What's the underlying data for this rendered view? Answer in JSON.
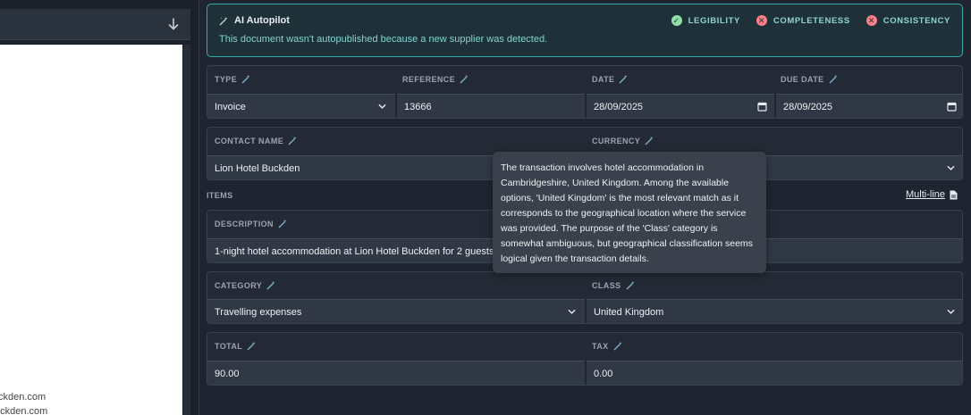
{
  "document_preview": {
    "text_lines": [
      "ckden.com",
      "uckden.com"
    ]
  },
  "autopilot": {
    "title": "AI Autopilot",
    "message": "This document wasn't autopublished because a new supplier was detected.",
    "checks": [
      {
        "label": "LEGIBILITY",
        "status": "pass"
      },
      {
        "label": "COMPLETENESS",
        "status": "fail"
      },
      {
        "label": "CONSISTENCY",
        "status": "fail"
      }
    ]
  },
  "fields": {
    "type": {
      "label": "TYPE",
      "value": "Invoice"
    },
    "reference": {
      "label": "REFERENCE",
      "value": "13666"
    },
    "date": {
      "label": "DATE",
      "value": "28/09/2025"
    },
    "due_date": {
      "label": "DUE DATE",
      "value": "28/09/2025"
    },
    "contact_name": {
      "label": "CONTACT NAME",
      "value": "Lion Hotel Buckden"
    },
    "currency": {
      "label": "CURRENCY",
      "value": ""
    }
  },
  "items": {
    "label": "ITEMS",
    "multiline_label": "Multi-line",
    "description": {
      "label": "DESCRIPTION",
      "value": "1-night hotel accommodation at Lion Hotel Buckden for 2 guests"
    },
    "category": {
      "label": "CATEGORY",
      "value": "Travelling expenses"
    },
    "class": {
      "label": "CLASS",
      "value": "United Kingdom"
    },
    "total": {
      "label": "TOTAL",
      "value": "90.00"
    },
    "tax": {
      "label": "TAX",
      "value": "0.00"
    }
  },
  "tooltip": {
    "text": "The transaction involves hotel accommodation in Cambridgeshire, United Kingdom. Among the available options, 'United Kingdom' is the most relevant match as it corresponds to the geographical location where the service was provided. The purpose of the 'Class' category is somewhat ambiguous, but geographical classification seems logical given the transaction details."
  },
  "colors": {
    "accent_teal": "#3aa8a8",
    "pass_green": "#8fe0a8",
    "fail_red": "#ff7f86"
  },
  "icons": {
    "wand": "magic-wand-icon",
    "chevron": "chevron-down-icon",
    "calendar": "calendar-icon",
    "download": "download-icon",
    "document": "document-icon"
  }
}
